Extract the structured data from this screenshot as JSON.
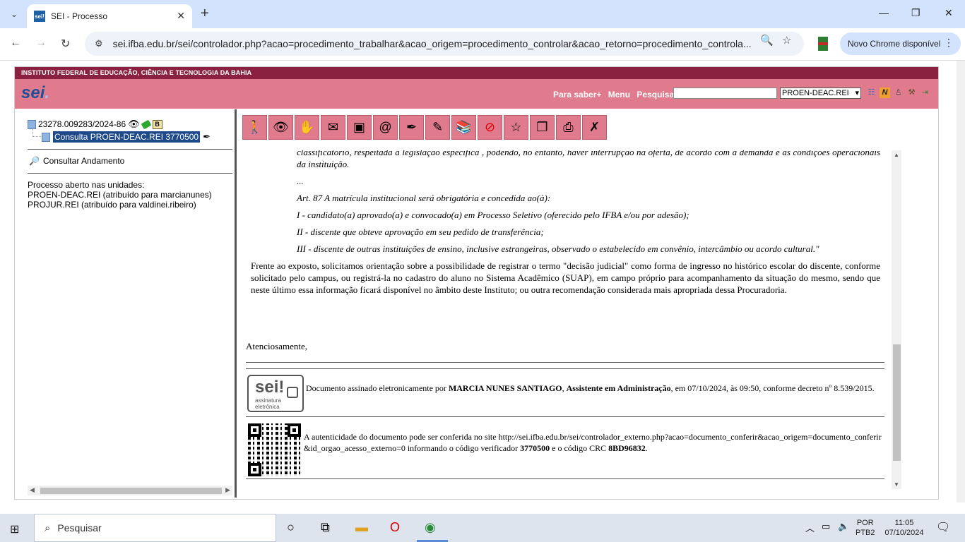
{
  "browser": {
    "tab_title": "SEI - Processo",
    "favicon_text": "sei!",
    "url": "sei.ifba.edu.br/sei/controlador.php?acao=procedimento_trabalhar&acao_origem=procedimento_controlar&acao_retorno=procedimento_controla...",
    "update_label": "Novo Chrome disponível"
  },
  "sei": {
    "institution": "INSTITUTO FEDERAL DE EDUCAÇÃO, CIÊNCIA E TECNOLOGIA DA BAHIA",
    "logo": "sei",
    "links": {
      "saber": "Para saber+",
      "menu": "Menu",
      "pesquisa": "Pesquisa"
    },
    "unit_selected": "PROEN-DEAC.REI",
    "brand_color": "#e07a8d",
    "inst_color": "#8b2140"
  },
  "tree": {
    "process_number": "23278.009283/2024-86",
    "document_label": "Consulta PROEN-DEAC.REI 3770500",
    "consultar_andamento": "Consultar Andamento",
    "open_units_title": "Processo aberto nas unidades:",
    "unit1": "PROEN-DEAC.REI (atribuído para marcianunes)",
    "unit2": "PROJUR.REI (atribuído para valdinei.ribeiro)"
  },
  "document": {
    "quote_top": "classificatório, respeitada a legislação específica , podendo, no entanto, haver interrupção na oferta, de acordo com a demanda e as condições operacionais da instituição.",
    "ellipsis": "...",
    "art87": "Art. 87 A matrícula institucional será obrigatória e concedida ao(à):",
    "item1": "I - candidato(a) aprovado(a) e convocado(a) em Processo Seletivo (oferecido pelo IFBA e/ou por adesão);",
    "item2": "II - discente que obteve aprovação em seu pedido de transferência;",
    "item3": "III - discente de outras instituições de ensino, inclusive estrangeiras, observado o estabelecido em convênio, intercâmbio ou acordo cultural.\"",
    "paragraph": "Frente ao exposto, solicitamos orientação sobre a possibilidade de registrar o termo \"decisão judicial\" como forma de ingresso no histórico escolar do discente, conforme solicitado pelo campus, ou registrá-la no cadastro do aluno no Sistema Acadêmico (SUAP), em campo próprio para acompanhamento da situação do mesmo, sendo que neste último essa informação ficará disponível no âmbito deste Instituto; ou outra recomendação considerada mais apropriada dessa Procuradoria.",
    "closing": "Atenciosamente,",
    "seal_big": "sei!",
    "seal_small1": "assinatura",
    "seal_small2": "eletrônica",
    "sig_prefix": "Documento assinado eletronicamente por ",
    "sig_name": "MARCIA NUNES SANTIAGO",
    "sig_sep": ", ",
    "sig_role": "Assistente em Administração",
    "sig_suffix": ", em 07/10/2024, às 09:50, conforme decreto nº 8.539/2015.",
    "auth_prefix": "A autenticidade do documento pode ser conferida no site http://sei.ifba.edu.br/sei/controlador_externo.php?acao=documento_conferir&acao_origem=documento_conferir&id_orgao_acesso_externo=0 informando o código verificador ",
    "auth_code": "3770500",
    "auth_mid": " e o código CRC ",
    "auth_crc": "8BD96832",
    "auth_end": "."
  },
  "taskbar": {
    "search": "Pesquisar",
    "lang1": "POR",
    "lang2": "PTB2",
    "time": "11:05",
    "date": "07/10/2024"
  }
}
